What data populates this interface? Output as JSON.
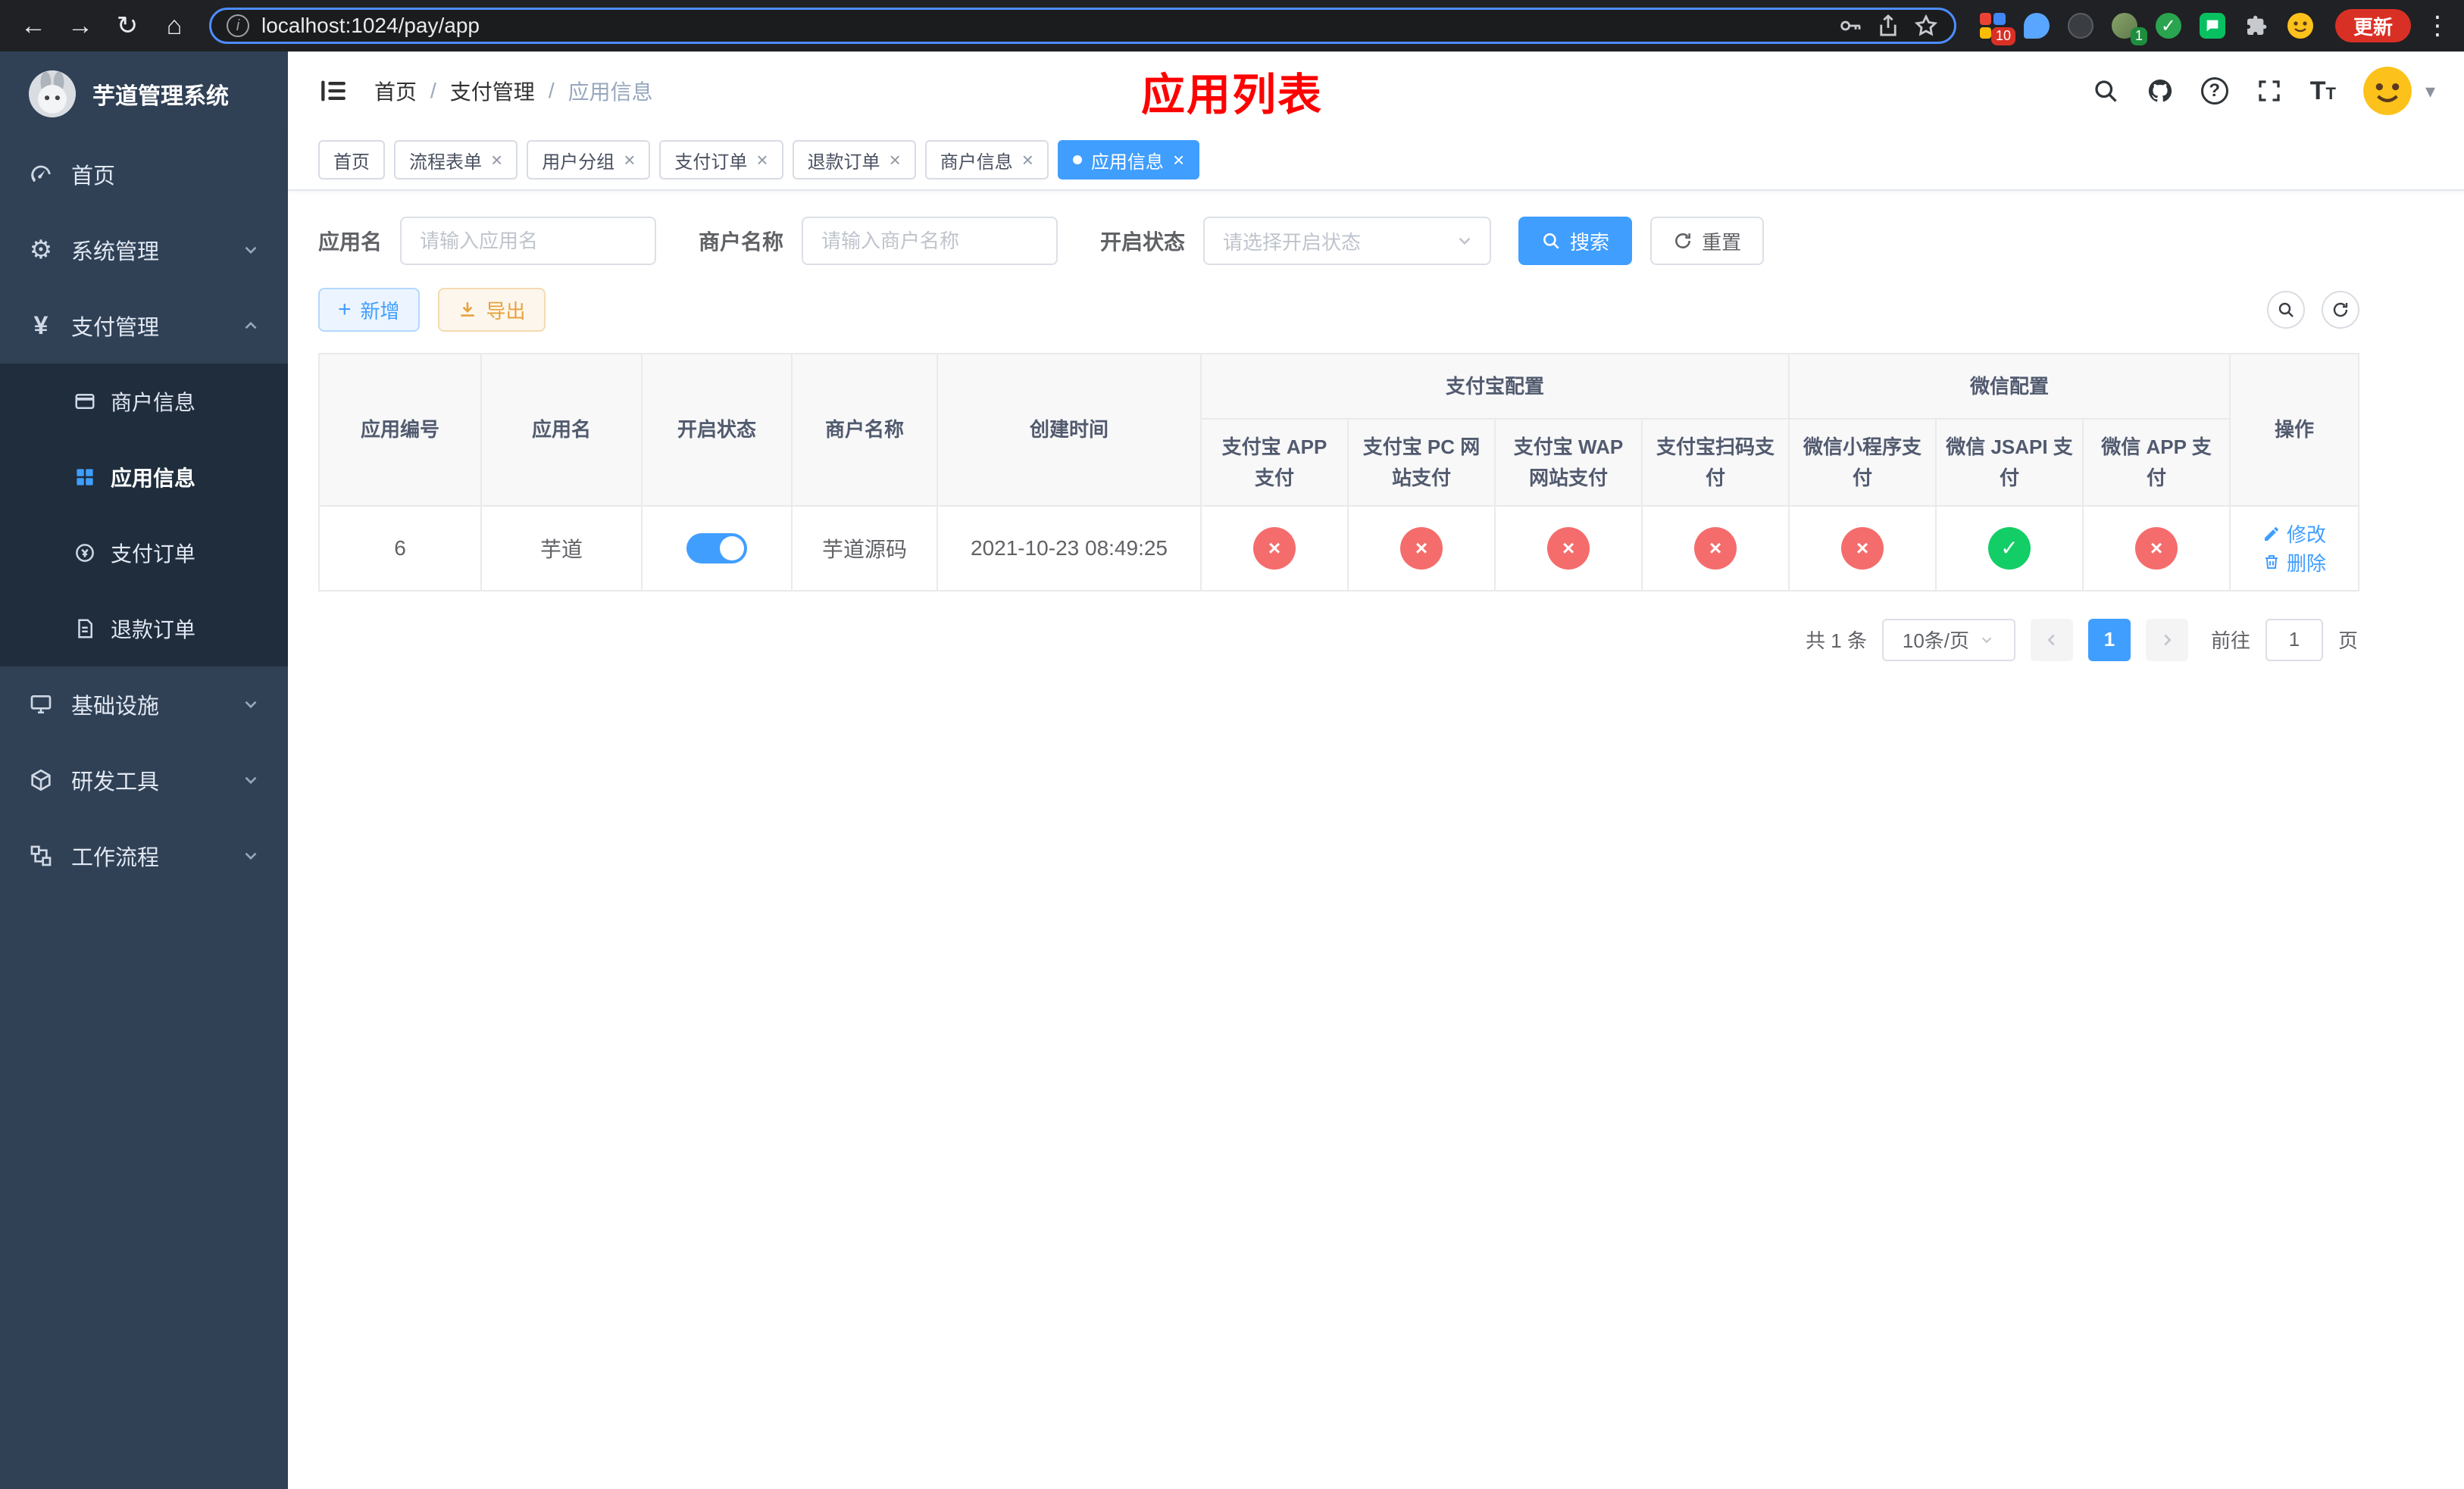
{
  "browser": {
    "url": "localhost:1024/pay/app",
    "update_label": "更新",
    "extension_badge_grid": "10",
    "extension_badge_avatar": "1"
  },
  "sidebar": {
    "logo_title": "芋道管理系统",
    "menu": [
      {
        "label": "首页"
      },
      {
        "label": "系统管理"
      },
      {
        "label": "支付管理"
      },
      {
        "label": "基础设施"
      },
      {
        "label": "研发工具"
      },
      {
        "label": "工作流程"
      }
    ],
    "submenu": [
      {
        "label": "商户信息"
      },
      {
        "label": "应用信息"
      },
      {
        "label": "支付订单"
      },
      {
        "label": "退款订单"
      }
    ]
  },
  "header": {
    "breadcrumb": [
      "首页",
      "支付管理",
      "应用信息"
    ],
    "page_title": "应用列表"
  },
  "tabs": [
    {
      "label": "首页",
      "closable": false,
      "active": false
    },
    {
      "label": "流程表单",
      "closable": true,
      "active": false
    },
    {
      "label": "用户分组",
      "closable": true,
      "active": false
    },
    {
      "label": "支付订单",
      "closable": true,
      "active": false
    },
    {
      "label": "退款订单",
      "closable": true,
      "active": false
    },
    {
      "label": "商户信息",
      "closable": true,
      "active": false
    },
    {
      "label": "应用信息",
      "closable": true,
      "active": true
    }
  ],
  "filters": {
    "app_name_label": "应用名",
    "app_name_placeholder": "请输入应用名",
    "merchant_label": "商户名称",
    "merchant_placeholder": "请输入商户名称",
    "status_label": "开启状态",
    "status_placeholder": "请选择开启状态",
    "search_label": "搜索",
    "reset_label": "重置"
  },
  "toolbar": {
    "add_label": "新增",
    "export_label": "导出"
  },
  "table": {
    "headers": {
      "app_id": "应用编号",
      "app_name": "应用名",
      "status": "开启状态",
      "merchant": "商户名称",
      "created": "创建时间",
      "alipay_group": "支付宝配置",
      "wechat_group": "微信配置",
      "actions": "操作"
    },
    "sub_headers": [
      "支付宝 APP 支付",
      "支付宝 PC 网站支付",
      "支付宝 WAP 网站支付",
      "支付宝扫码支付",
      "微信小程序支付",
      "微信 JSAPI 支付",
      "微信 APP 支付"
    ],
    "rows": [
      {
        "app_id": "6",
        "app_name": "芋道",
        "status_on": true,
        "merchant": "芋道源码",
        "created": "2021-10-23 08:49:25",
        "pay_status": [
          "no",
          "no",
          "no",
          "no",
          "no",
          "yes",
          "no"
        ],
        "edit_label": "修改",
        "delete_label": "删除"
      }
    ]
  },
  "pagination": {
    "total_text": "共 1 条",
    "page_size": "10条/页",
    "current_page": "1",
    "goto_label": "前往",
    "goto_value": "1",
    "page_suffix": "页"
  },
  "colors": {
    "accent": "#409EFF",
    "danger": "#f56c6c",
    "success": "#13ce66",
    "warning": "#e6a23c",
    "title_red": "#ff0000",
    "sidebar_bg": "#304156",
    "submenu_bg": "#1f2d3d"
  }
}
